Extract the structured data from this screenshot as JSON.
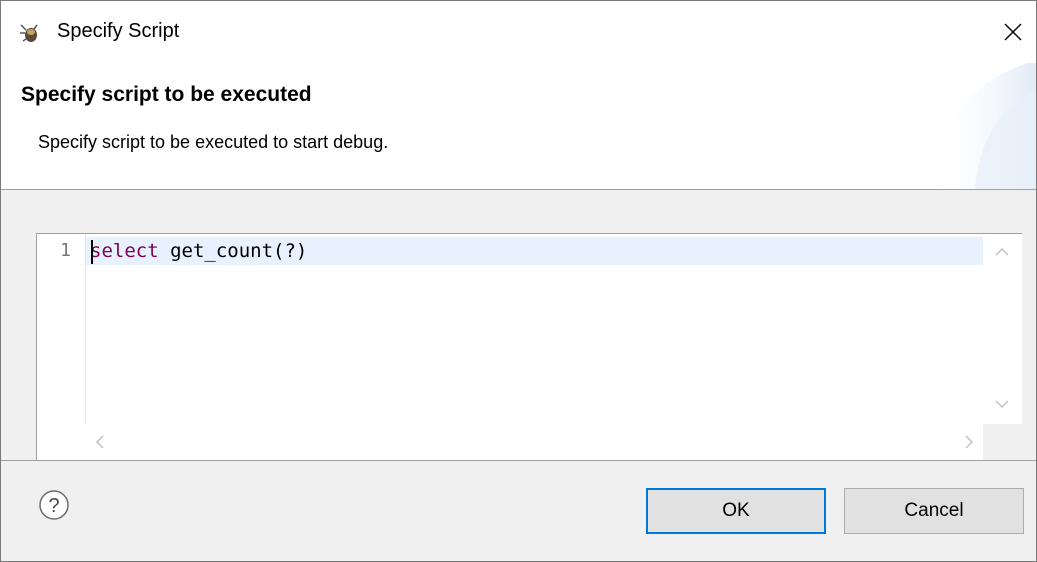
{
  "window": {
    "title": "Specify Script",
    "icon": "debug-bug-icon",
    "close_icon": "close-icon"
  },
  "header": {
    "title": "Specify script to be executed",
    "description": "Specify script to be executed to start debug."
  },
  "editor": {
    "line_number": "1",
    "keyword": "select",
    "code_rest": " get_count(?)",
    "colors": {
      "keyword": "#7f0055",
      "current_line": "#e8f2fe"
    }
  },
  "footer": {
    "help_icon": "help-question-icon",
    "ok_label": "OK",
    "cancel_label": "Cancel",
    "default_button_border": "#0078d7"
  }
}
